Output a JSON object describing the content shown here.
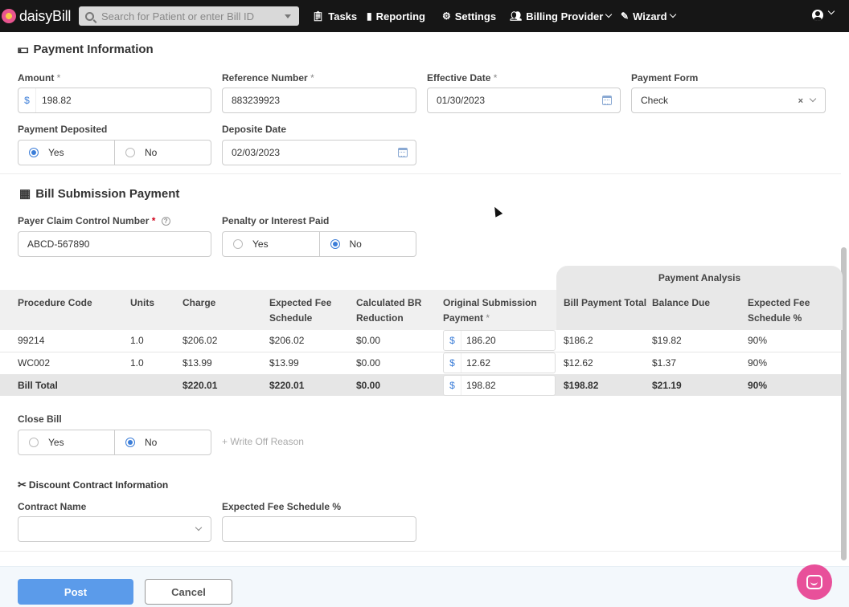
{
  "navbar": {
    "logo_text": "daisyBill",
    "search_placeholder": "Search for Patient or enter Bill ID",
    "items": [
      {
        "label": "Tasks",
        "icon": "clipboard-icon"
      },
      {
        "label": "Reporting",
        "icon": "bar-chart-icon"
      },
      {
        "label": "Settings",
        "icon": "gear-icon"
      },
      {
        "label": "Billing Provider",
        "icon": "users-icon"
      },
      {
        "label": "Wizard",
        "icon": "magic-wand-icon"
      }
    ]
  },
  "payment_information": {
    "title": "Payment Information",
    "amount": {
      "label": "Amount",
      "req": "*",
      "prefix": "$",
      "value": "198.82"
    },
    "reference_number": {
      "label": "Reference Number",
      "req": "*",
      "value": "883239923"
    },
    "effective_date": {
      "label": "Effective Date",
      "req": "*",
      "value": "01/30/2023"
    },
    "payment_form": {
      "label": "Payment Form",
      "value": "Check",
      "clear": "×"
    },
    "payment_deposited": {
      "label": "Payment Deposited",
      "yes": "Yes",
      "no": "No",
      "selected": "Yes"
    },
    "deposite_date": {
      "label": "Deposite Date",
      "value": "02/03/2023"
    }
  },
  "bill_submission_payment": {
    "title": "Bill Submission Payment",
    "payer_claim_control_number": {
      "label": "Payer Claim Control Number",
      "req": "*",
      "help": "?",
      "value": "ABCD-567890"
    },
    "penalty_or_interest_paid": {
      "label": "Penalty or Interest Paid",
      "yes": "Yes",
      "no": "No",
      "selected": "No"
    }
  },
  "table": {
    "analysis_header": "Payment Analysis",
    "columns": {
      "procedure_code": "Procedure Code",
      "units": "Units",
      "charge": "Charge",
      "expected_fee_schedule_1": "Expected Fee",
      "expected_fee_schedule_2": "Schedule",
      "calculated_br_reduction_1": "Calculated BR",
      "calculated_br_reduction_2": "Reduction",
      "original_submission_payment_1": "Original Submission",
      "original_submission_payment_2": "Payment",
      "original_submission_payment_req": "*",
      "bill_payment_total": "Bill Payment Total",
      "balance_due": "Balance Due",
      "expected_fee_schedule_pct_1": "Expected Fee",
      "expected_fee_schedule_pct_2": "Schedule %"
    },
    "rows": [
      {
        "procedure_code": "99214",
        "units": "1.0",
        "charge": "$206.02",
        "expected_fee_schedule": "$206.02",
        "calculated_br_reduction": "$0.00",
        "payment_prefix": "$",
        "original_submission_payment": "186.20",
        "bill_payment_total": "$186.2",
        "balance_due": "$19.82",
        "expected_fee_schedule_pct": "90%"
      },
      {
        "procedure_code": "WC002",
        "units": "1.0",
        "charge": "$13.99",
        "expected_fee_schedule": "$13.99",
        "calculated_br_reduction": "$0.00",
        "payment_prefix": "$",
        "original_submission_payment": "12.62",
        "bill_payment_total": "$12.62",
        "balance_due": "$1.37",
        "expected_fee_schedule_pct": "90%"
      }
    ],
    "total": {
      "label": "Bill Total",
      "charge": "$220.01",
      "expected_fee_schedule": "$220.01",
      "calculated_br_reduction": "$0.00",
      "payment_prefix": "$",
      "original_submission_payment": "198.82",
      "bill_payment_total": "$198.82",
      "balance_due": "$21.19",
      "expected_fee_schedule_pct": "90%"
    }
  },
  "close_bill": {
    "label": "Close Bill",
    "yes": "Yes",
    "no": "No",
    "selected": "No",
    "write_off": "+ Write Off Reason"
  },
  "discount_contract": {
    "title": "Discount Contract Information",
    "contract_name": {
      "label": "Contract Name",
      "value": ""
    },
    "expected_fee_schedule_pct": {
      "label": "Expected Fee Schedule %",
      "value": ""
    }
  },
  "footer": {
    "post": "Post",
    "cancel": "Cancel"
  },
  "colors": {
    "accent": "#3b7dd8",
    "post_button": "#5b9bea",
    "chat": "#e8509a",
    "navbar": "#161616"
  }
}
